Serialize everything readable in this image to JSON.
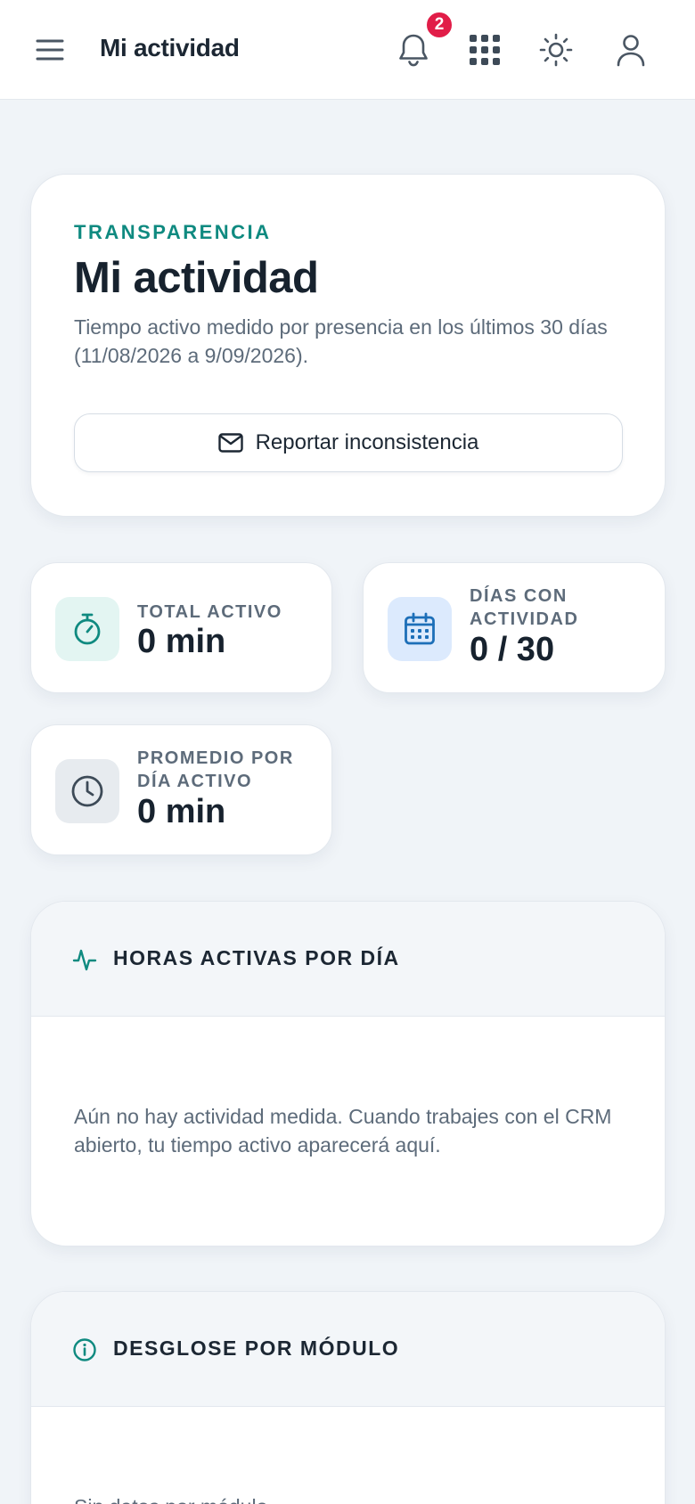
{
  "header": {
    "title": "Mi actividad",
    "notifications_count": "2",
    "icons": [
      "menu-icon",
      "bell-icon",
      "apps-grid-icon",
      "sun-icon",
      "user-icon"
    ]
  },
  "hero": {
    "eyebrow": "TRANSPARENCIA",
    "title": "Mi actividad",
    "description": "Tiempo activo medido por presencia en los últimos 30 días (11/08/2026 a 9/09/2026).",
    "report_button": "Reportar inconsistencia"
  },
  "stats": [
    {
      "label": "TOTAL ACTIVO",
      "value": "0 min",
      "icon": "stopwatch-icon"
    },
    {
      "label": "DÍAS CON ACTIVIDAD",
      "value": "0 / 30",
      "icon": "calendar-icon"
    },
    {
      "label": "PROMEDIO POR DÍA ACTIVO",
      "value": "0 min",
      "icon": "clock-icon"
    }
  ],
  "sections": [
    {
      "title": "HORAS ACTIVAS POR DÍA",
      "icon": "activity-icon",
      "empty_text": "Aún no hay actividad medida. Cuando trabajes con el CRM abierto, tu tiempo activo aparecerá aquí."
    },
    {
      "title": "DESGLOSE POR MÓDULO",
      "icon": "info-icon",
      "empty_text": "Sin datos por módulo."
    }
  ],
  "colors": {
    "accent": "#0f8a80",
    "badge": "#e11d48",
    "background": "#f0f4f8",
    "calendar_icon": "#1d6fb8"
  }
}
